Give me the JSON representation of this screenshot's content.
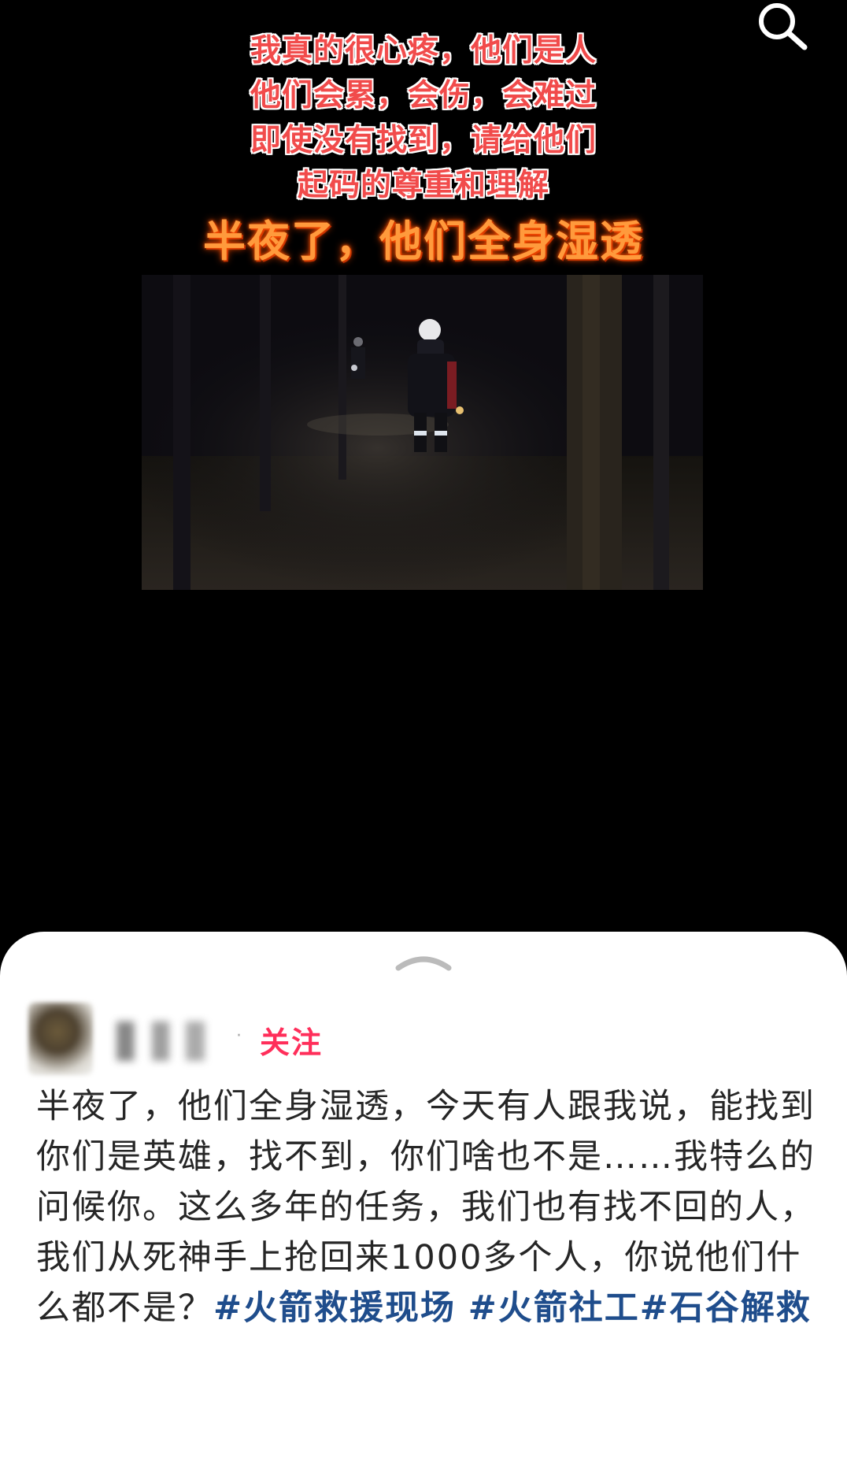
{
  "header": {
    "search_icon": "search-icon"
  },
  "video": {
    "caption_lines": [
      "我真的很心疼，他们是人",
      "他们会累，会伤，会难过",
      "即使没有找到，请给他们",
      "起码的尊重和理解"
    ],
    "headline": "半夜了，他们全身湿透",
    "colors": {
      "caption": "#f14b4b",
      "headline": "#ff9a3c"
    }
  },
  "sheet": {
    "handle_icon": "chevron-up-icon",
    "author": {
      "dot": "·",
      "follow_label": "关注",
      "follow_color": "#ff2e5a"
    },
    "post": {
      "text": "半夜了，他们全身湿透，今天有人跟我说，能找到你们是英雄，找不到，你们啥也不是……我特么的问候你。这么多年的任务，我们也有找不回的人，我们从死神手上抢回来1000多个人，你说他们什么都不是？",
      "hashtags": [
        "#火箭救援现场",
        "#火箭社工",
        "#石谷解救"
      ],
      "hashtag_color": "#1f4d8c"
    }
  }
}
